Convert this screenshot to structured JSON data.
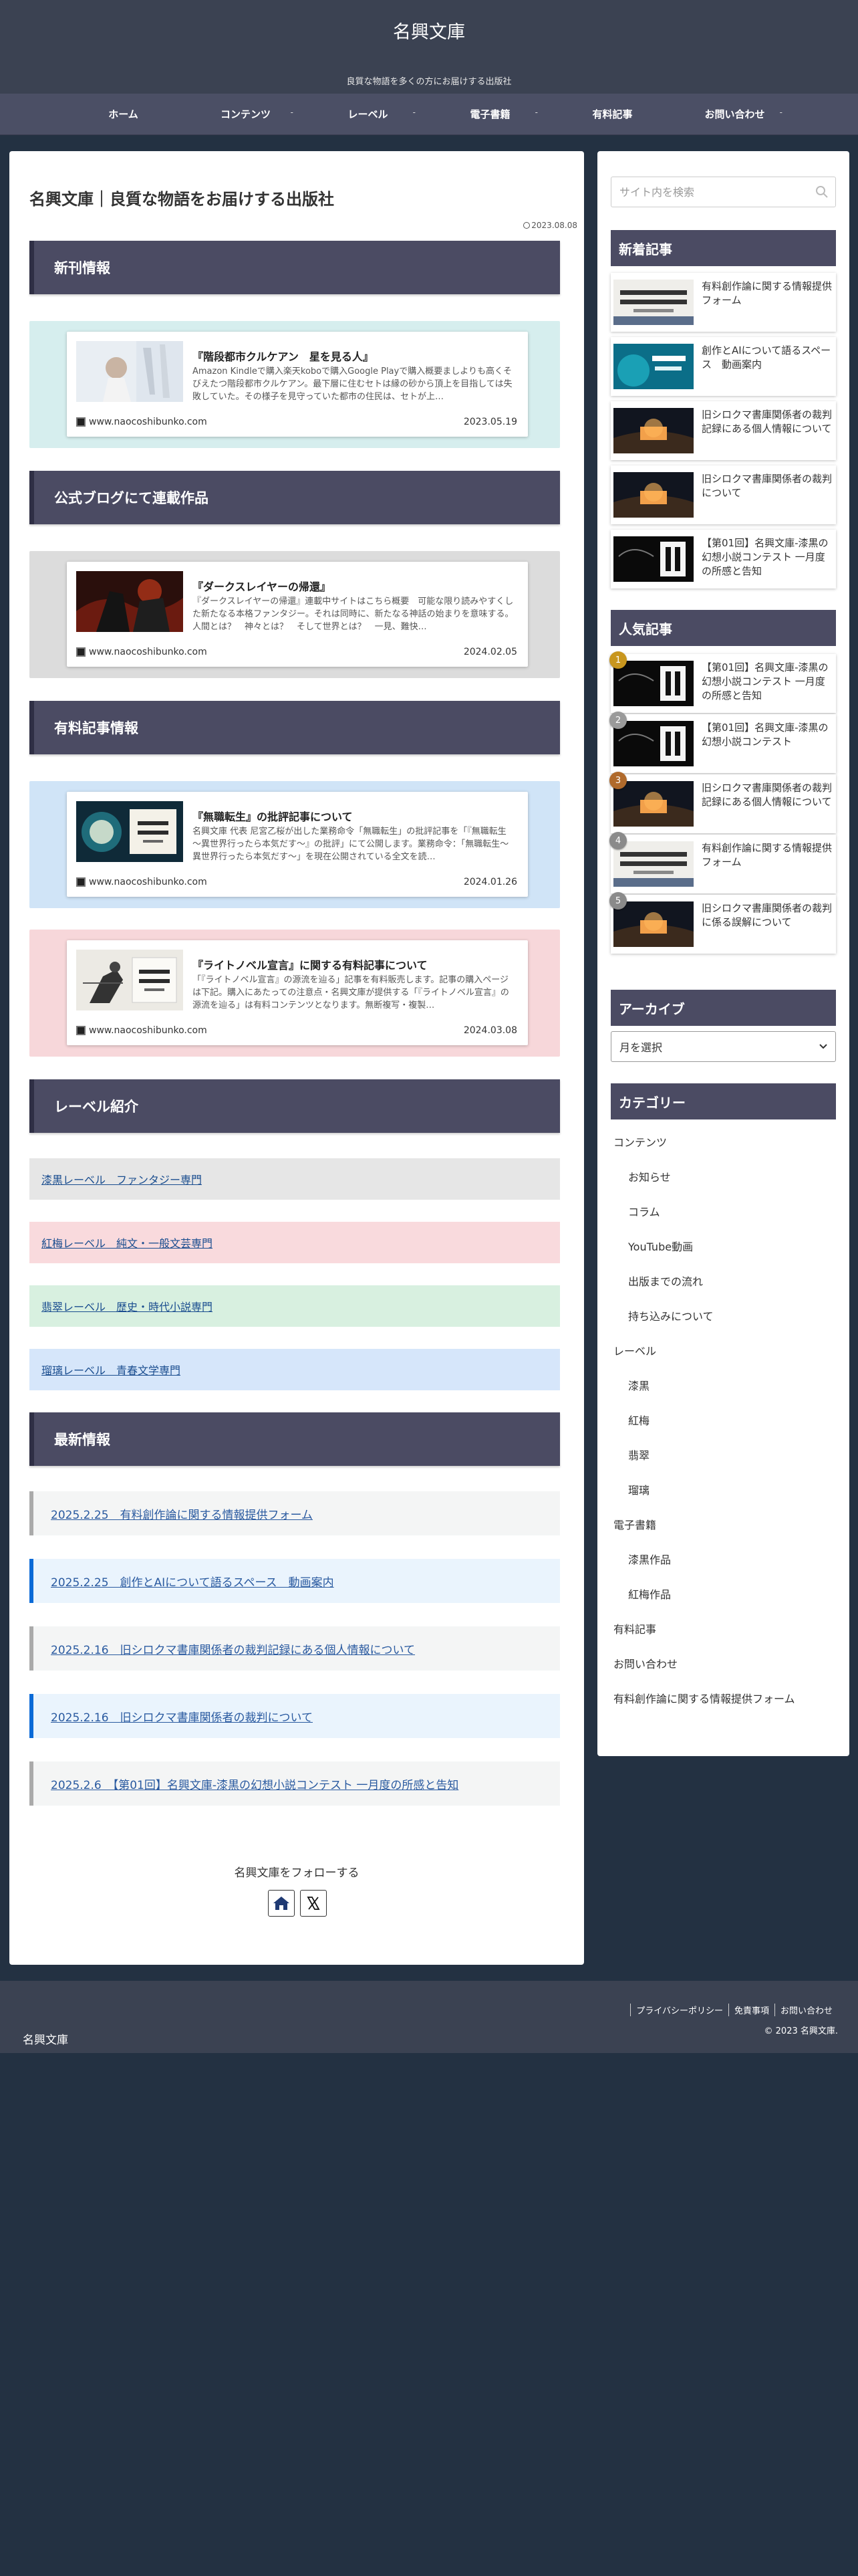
{
  "site": {
    "title": "名興文庫",
    "tagline": "良質な物語を多くの方にお届けする出版社"
  },
  "nav": [
    {
      "label": "ホーム",
      "dropdown": false
    },
    {
      "label": "コンテンツ",
      "dropdown": true
    },
    {
      "label": "レーベル",
      "dropdown": true
    },
    {
      "label": "電子書籍",
      "dropdown": true
    },
    {
      "label": "有料記事",
      "dropdown": false
    },
    {
      "label": "お問い合わせ",
      "dropdown": true
    }
  ],
  "nav_dropdown_symbol": "-",
  "page": {
    "title": "名興文庫｜良質な物語をお届けする出版社",
    "date": "2023.08.08"
  },
  "sections": {
    "new_release": "新刊情報",
    "blog_serial": "公式ブログにて連載作品",
    "paid_articles": "有料記事情報",
    "labels": "レーベル紹介",
    "latest": "最新情報"
  },
  "cards": [
    {
      "title": "『階段都市クルケアン　星を見る人』",
      "excerpt": "Amazon Kindleで購入楽天koboで購入Google Playで購入概要ましよりも高くそびえたつ階段都市クルケアン。最下層に住むセトは縁の砂から頂上を目指しては失敗していた。その様子を見守っていた都市の住民は、セトが上…",
      "site": "www.naocoshibunko.com",
      "date": "2023.05.19",
      "bg": "#d6eeee"
    },
    {
      "title": "『ダークスレイヤーの帰還』",
      "excerpt": "『ダークスレイヤーの帰還』連載中サイトはこちら概要　可能な限り読みやすくした新たなる本格ファンタジー。それは同時に、新たなる神話の始まりを意味する。 人間とは？　神々とは？　そして世界とは？　一見、難快…",
      "site": "www.naocoshibunko.com",
      "date": "2024.02.05",
      "bg": "#dcdcdc"
    },
    {
      "title": "『無職転生』の批評記事について",
      "excerpt": "名興文庫 代表 尼宮乙桜が出した業務命令「無職転生」の批評記事を「『無職転生～異世界行ったら本気だす～』の批評」にて公開します。業務命令：「無職転生～異世界行ったら本気だす～」を現在公開されている全文を読…",
      "site": "www.naocoshibunko.com",
      "date": "2024.01.26",
      "bg": "#d0e4f7"
    },
    {
      "title": "『ライトノベル宣言』に関する有料記事について",
      "excerpt": "「『ライトノベル宣言』の源流を辿る」記事を有料販売します。記事の購入ページは下記。購入にあたっての注意点・名興文庫が提供する「『ライトノベル宣言』の源流を辿る」は有料コンテンツとなります。無断複写・複製…",
      "site": "www.naocoshibunko.com",
      "date": "2024.03.08",
      "bg": "#f7d7da"
    }
  ],
  "labels": [
    {
      "text": "漆黒レーベル　ファンタジー専門",
      "bg": "#e6e6e6"
    },
    {
      "text": "紅梅レーベル　純文・一般文芸専門",
      "bg": "#f9dadd"
    },
    {
      "text": "翡翠レーベル　歴史・時代小説専門",
      "bg": "#d8f0e0"
    },
    {
      "text": "瑠璃レーベル　青春文学専門",
      "bg": "#d6e6fa"
    }
  ],
  "news": [
    "2025.2.25　有料創作論に関する情報提供フォーム",
    "2025.2.25　創作とAIについて語るスペース　動画案内",
    "2025.2.16　旧シロクマ書庫関係者の裁判記録にある個人情報について",
    "2025.2.16　旧シロクマ書庫関係者の裁判について",
    "2025.2.6　【第01回】名興文庫-漆黒の幻想小説コンテスト 一月度の所感と告知"
  ],
  "follow": {
    "label": "名興文庫をフォローする"
  },
  "sidebar": {
    "search_placeholder": "サイト内を検索",
    "recent_heading": "新着記事",
    "recent": [
      "有料創作論に関する情報提供フォーム",
      "創作とAIについて語るスペース　動画案内",
      "旧シロクマ書庫関係者の裁判記録にある個人情報について",
      "旧シロクマ書庫関係者の裁判について",
      "【第01回】名興文庫-漆黒の幻想小説コンテスト 一月度の所感と告知"
    ],
    "popular_heading": "人気記事",
    "popular": [
      {
        "rank": "1",
        "text": "【第01回】名興文庫-漆黒の幻想小説コンテスト 一月度の所感と告知",
        "color": "#c8961e"
      },
      {
        "rank": "2",
        "text": "【第01回】名興文庫-漆黒の幻想小説コンテスト",
        "color": "#9a9a9a"
      },
      {
        "rank": "3",
        "text": "旧シロクマ書庫関係者の裁判記録にある個人情報について",
        "color": "#b06a2c"
      },
      {
        "rank": "4",
        "text": "有料創作論に関する情報提供フォーム",
        "color": "#8a8a8a"
      },
      {
        "rank": "5",
        "text": "旧シロクマ書庫関係者の裁判に係る誤解について",
        "color": "#8a8a8a"
      }
    ],
    "archive_heading": "アーカイブ",
    "archive_select": "月を選択",
    "category_heading": "カテゴリー",
    "categories": [
      {
        "text": "コンテンツ",
        "sub": false
      },
      {
        "text": "お知らせ",
        "sub": true
      },
      {
        "text": "コラム",
        "sub": true
      },
      {
        "text": "YouTube動画",
        "sub": true
      },
      {
        "text": "出版までの流れ",
        "sub": true
      },
      {
        "text": "持ち込みについて",
        "sub": true
      },
      {
        "text": "レーベル",
        "sub": false
      },
      {
        "text": "漆黒",
        "sub": true
      },
      {
        "text": "紅梅",
        "sub": true
      },
      {
        "text": "翡翠",
        "sub": true
      },
      {
        "text": "瑠璃",
        "sub": true
      },
      {
        "text": "電子書籍",
        "sub": false
      },
      {
        "text": "漆黒作品",
        "sub": true
      },
      {
        "text": "紅梅作品",
        "sub": true
      },
      {
        "text": "有料記事",
        "sub": false
      },
      {
        "text": "お問い合わせ",
        "sub": false
      },
      {
        "text": "有料創作論に関する情報提供フォーム",
        "sub": false
      }
    ]
  },
  "footer": {
    "links": [
      "プライバシーポリシー",
      "免責事項",
      "お問い合わせ"
    ],
    "copyright": "© 2023 名興文庫.",
    "logo": "名興文庫"
  }
}
